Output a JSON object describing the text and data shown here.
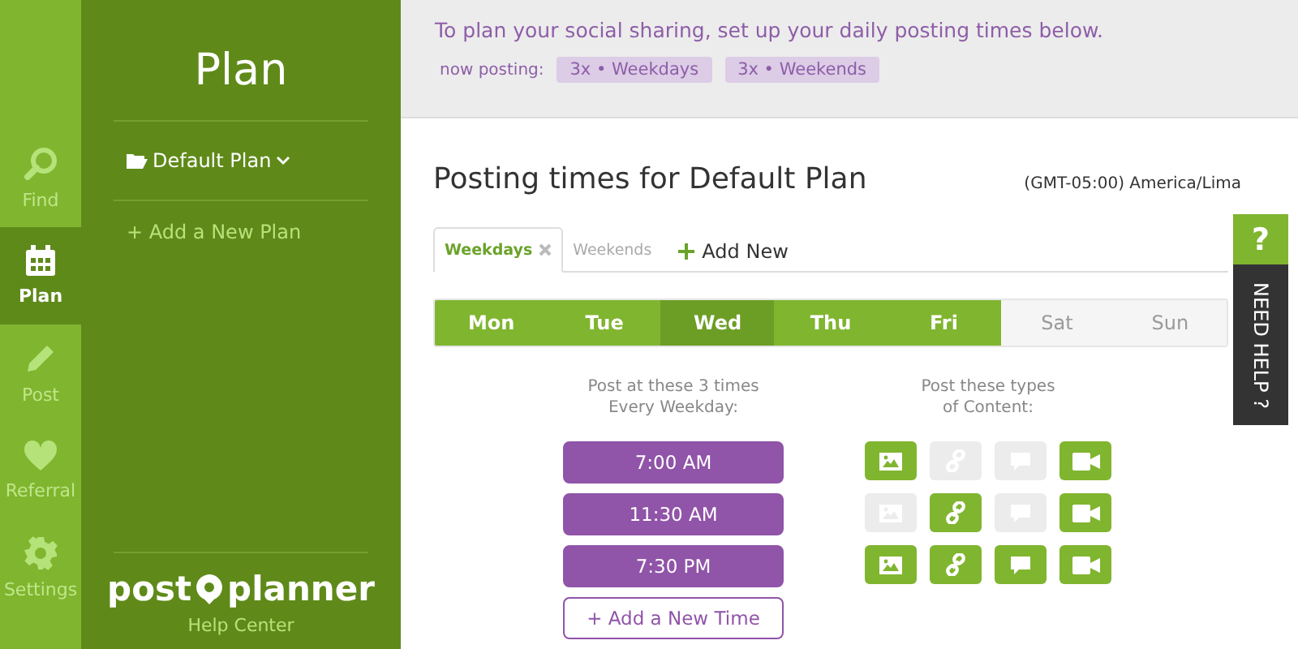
{
  "rail": {
    "items": [
      {
        "label": "Find",
        "selected": false
      },
      {
        "label": "Plan",
        "selected": true
      },
      {
        "label": "Post",
        "selected": false
      },
      {
        "label": "Referral",
        "selected": false
      },
      {
        "label": "Settings",
        "selected": false
      }
    ]
  },
  "plan_panel": {
    "title": "Plan",
    "current_plan": "Default Plan",
    "add_plan": "+ Add a New Plan",
    "logo": {
      "left": "post",
      "right": "planner"
    },
    "help_link": "Help Center"
  },
  "banner": {
    "message": "To plan your social sharing, set up your daily posting times below.",
    "now_posting_label": "now posting:",
    "chips": [
      "3x • Weekdays",
      "3x • Weekends"
    ]
  },
  "heading": "Posting times for Default Plan",
  "timezone": "(GMT-05:00) America/Lima",
  "tabs": [
    {
      "label": "Weekdays",
      "selected": true,
      "closable": true
    },
    {
      "label": "Weekends",
      "selected": false,
      "closable": false
    }
  ],
  "add_new": "Add New",
  "days": [
    {
      "label": "Mon",
      "selected": true,
      "highlighted": false
    },
    {
      "label": "Tue",
      "selected": true,
      "highlighted": false
    },
    {
      "label": "Wed",
      "selected": true,
      "highlighted": true
    },
    {
      "label": "Thu",
      "selected": true,
      "highlighted": false
    },
    {
      "label": "Fri",
      "selected": true,
      "highlighted": false
    },
    {
      "label": "Sat",
      "selected": false,
      "highlighted": false
    },
    {
      "label": "Sun",
      "selected": false,
      "highlighted": false
    }
  ],
  "times_header": "Post at these 3 times\nEvery Weekday:",
  "types_header": "Post these types\nof Content:",
  "slots": [
    {
      "time": "7:00 AM",
      "types": [
        {
          "kind": "image",
          "on": true
        },
        {
          "kind": "link",
          "on": false
        },
        {
          "kind": "comment",
          "on": false
        },
        {
          "kind": "video",
          "on": true
        }
      ]
    },
    {
      "time": "11:30 AM",
      "types": [
        {
          "kind": "image",
          "on": false
        },
        {
          "kind": "link",
          "on": true
        },
        {
          "kind": "comment",
          "on": false
        },
        {
          "kind": "video",
          "on": true
        }
      ]
    },
    {
      "time": "7:30 PM",
      "types": [
        {
          "kind": "image",
          "on": true
        },
        {
          "kind": "link",
          "on": true
        },
        {
          "kind": "comment",
          "on": true
        },
        {
          "kind": "video",
          "on": true
        }
      ]
    }
  ],
  "add_time": "+ Add a New Time",
  "help": {
    "mark": "?",
    "label": "NEED HELP ?"
  }
}
